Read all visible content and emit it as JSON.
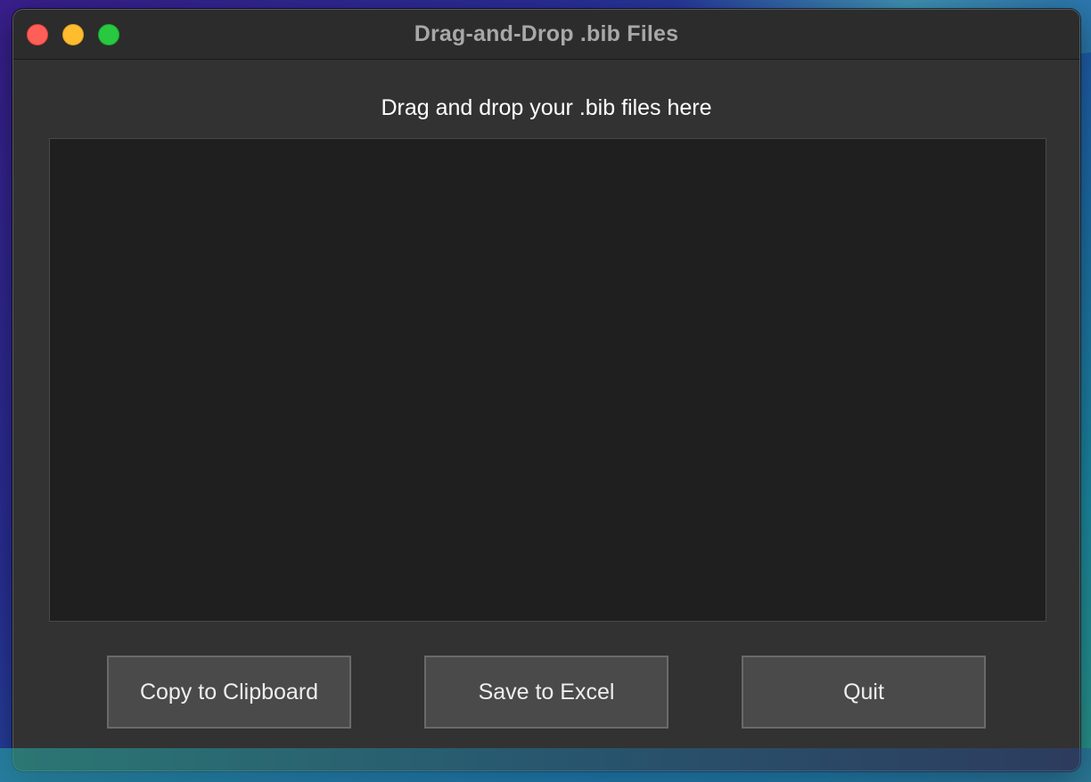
{
  "window": {
    "title": "Drag-and-Drop .bib Files"
  },
  "main": {
    "instruction": "Drag and drop your .bib files here",
    "dropzone_content": ""
  },
  "buttons": {
    "copy_label": "Copy to Clipboard",
    "save_label": "Save to Excel",
    "quit_label": "Quit"
  },
  "colors": {
    "window_bg": "#323232",
    "dropzone_bg": "#1f1f1f",
    "button_bg": "#4a4a4a",
    "close": "#ff5f57",
    "minimize": "#febc2e",
    "maximize": "#28c840"
  },
  "icons": {
    "close": "close-icon",
    "minimize": "minimize-icon",
    "maximize": "maximize-icon"
  }
}
